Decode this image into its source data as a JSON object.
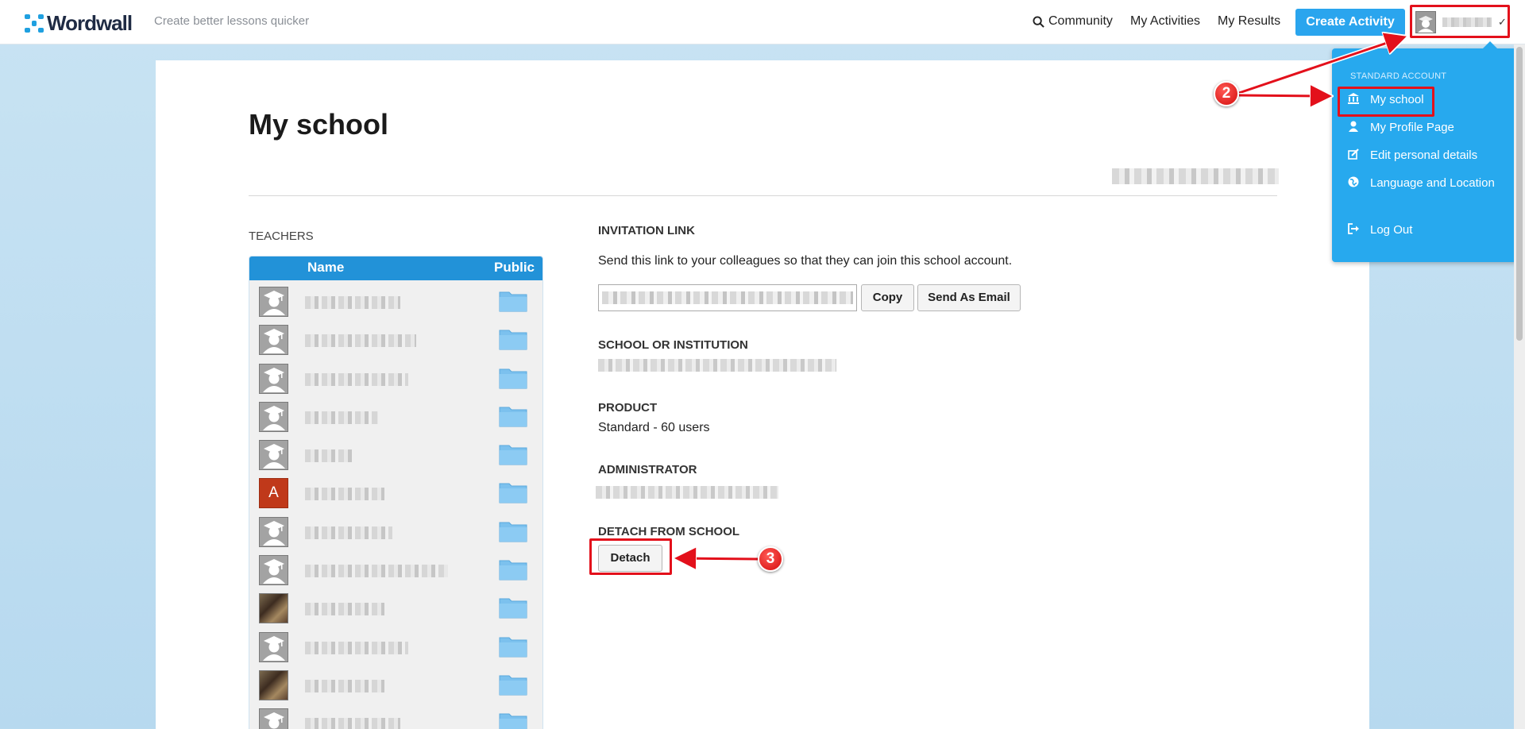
{
  "header": {
    "logo_text": "Wordwall",
    "tagline": "Create better lessons quicker",
    "nav": {
      "community": "Community",
      "my_activities": "My Activities",
      "my_results": "My Results"
    },
    "create_activity": "Create Activity"
  },
  "dropdown": {
    "header": "STANDARD ACCOUNT",
    "items": [
      {
        "label": "My school",
        "icon": "bank-icon"
      },
      {
        "label": "My Profile Page",
        "icon": "user-icon"
      },
      {
        "label": "Edit personal details",
        "icon": "edit-icon"
      },
      {
        "label": "Language and Location",
        "icon": "globe-icon"
      },
      {
        "label": "Log Out",
        "icon": "logout-icon"
      }
    ]
  },
  "page": {
    "title": "My school",
    "teachers_label": "TEACHERS",
    "table_headers": {
      "name": "Name",
      "public": "Public"
    },
    "teachers": [
      {
        "avatar": "default"
      },
      {
        "avatar": "default"
      },
      {
        "avatar": "default"
      },
      {
        "avatar": "default"
      },
      {
        "avatar": "default"
      },
      {
        "avatar": "letter",
        "letter": "A"
      },
      {
        "avatar": "default"
      },
      {
        "avatar": "default"
      },
      {
        "avatar": "photo"
      },
      {
        "avatar": "default"
      },
      {
        "avatar": "photo"
      },
      {
        "avatar": "default"
      }
    ],
    "invitation": {
      "label": "INVITATION LINK",
      "description": "Send this link to your colleagues so that they can join this school account.",
      "copy": "Copy",
      "send_email": "Send As Email"
    },
    "school": {
      "label": "SCHOOL OR INSTITUTION"
    },
    "product": {
      "label": "PRODUCT",
      "value": "Standard - 60 users"
    },
    "administrator": {
      "label": "ADMINISTRATOR"
    },
    "detach": {
      "label": "DETACH FROM SCHOOL",
      "button": "Detach"
    }
  },
  "annotations": {
    "step2": "2",
    "step3": "3"
  },
  "colors": {
    "accent": "#27a9ee",
    "table_header": "#2292d8",
    "annotation": "#e3101b"
  }
}
